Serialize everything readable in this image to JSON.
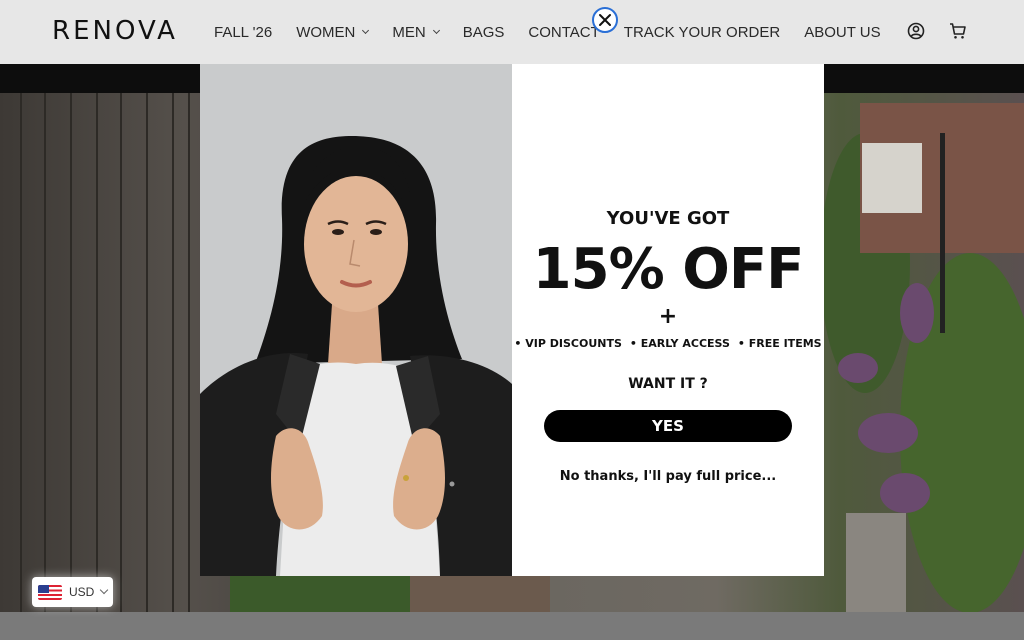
{
  "header": {
    "logo": "RENOVA",
    "nav": [
      {
        "label": "FALL '26",
        "has_dropdown": false
      },
      {
        "label": "WOMEN",
        "has_dropdown": true
      },
      {
        "label": "MEN",
        "has_dropdown": true
      },
      {
        "label": "BAGS",
        "has_dropdown": false
      },
      {
        "label": "CONTACT",
        "has_dropdown": false
      },
      {
        "label": "TRACK YOUR ORDER",
        "has_dropdown": false
      },
      {
        "label": "ABOUT US",
        "has_dropdown": false
      }
    ],
    "icons": [
      "account-icon",
      "cart-icon"
    ]
  },
  "popup": {
    "kicker": "YOU'VE GOT",
    "headline": "15% OFF",
    "plus": "+",
    "perks": [
      "• VIP DISCOUNTS",
      "• EARLY ACCESS",
      "• FREE ITEMS"
    ],
    "question": "WANT IT ?",
    "yes_label": "YES",
    "decline_label": "No thanks, I'll pay full price...",
    "close_icon": "close-icon"
  },
  "currency": {
    "code": "USD",
    "flag_icon": "us-flag-icon"
  },
  "colors": {
    "header_bg": "#e7e7e7",
    "announcement_bar": "#0d0d0d",
    "yes_button": "#000000",
    "close_ring": "#2a6fd6"
  }
}
